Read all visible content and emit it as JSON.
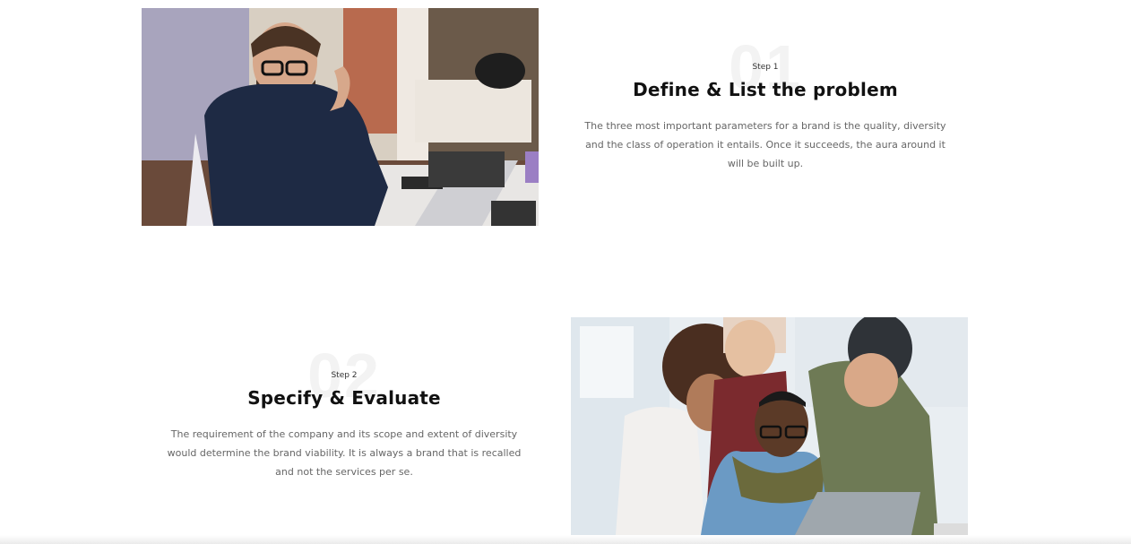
{
  "steps": [
    {
      "number": "01",
      "label": "Step 1",
      "title": "Define & List the problem",
      "description": "The three most important parameters for a brand is the quality, diversity and the class of operation it entails. Once it succeeds, the aura around it will be built up."
    },
    {
      "number": "02",
      "label": "Step 2",
      "title": "Specify & Evaluate",
      "description": "The requirement of the company and its scope and extent of diversity would determine the brand viability. It is always a brand that is recalled and not the services per se."
    }
  ],
  "images": [
    {
      "name": "man-working-on-laptop-photo"
    },
    {
      "name": "team-around-laptop-photo"
    }
  ]
}
